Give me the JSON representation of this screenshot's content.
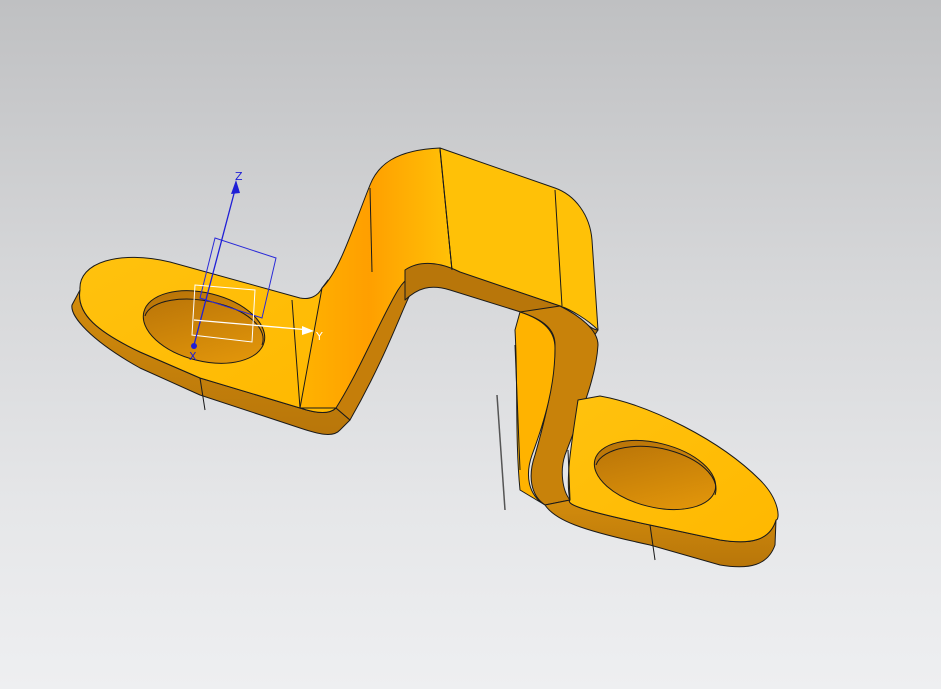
{
  "viewport": {
    "background_top": "#bfc0c2",
    "background_bottom": "#eeeff1"
  },
  "part": {
    "face_color": "#ffc107",
    "side_color": "#c8820a",
    "edge_color": "#1a1a1a"
  },
  "triad": {
    "z_label": "Z",
    "y_label": "Y",
    "x_label": "X",
    "z_color": "#1f1fd6",
    "y_color": "#ffffff",
    "x_color": "#1f1fd6"
  }
}
